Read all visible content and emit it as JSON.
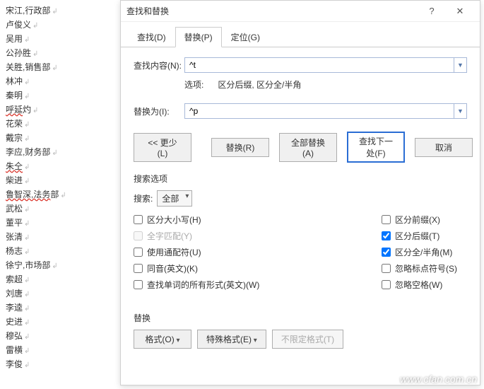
{
  "doc_lines": [
    {
      "text": "宋江,行政部",
      "wavy": false
    },
    {
      "text": "卢俊义",
      "wavy": false
    },
    {
      "text": "吴用",
      "wavy": false
    },
    {
      "text": "公孙胜",
      "wavy": false
    },
    {
      "text": "关胜,销售部",
      "wavy": false
    },
    {
      "text": "林冲",
      "wavy": false
    },
    {
      "text": "秦明",
      "wavy": false
    },
    {
      "text": "呼延",
      "wavy": true,
      "suffix": "灼"
    },
    {
      "text": "花荣",
      "wavy": false
    },
    {
      "text": "戴宗",
      "wavy": false
    },
    {
      "text": "李应,财务部",
      "wavy": false
    },
    {
      "text": "朱仝",
      "wavy": true
    },
    {
      "text": "柴进",
      "wavy": false
    },
    {
      "text": "鲁智深,法务",
      "wavy": true,
      "suffix": "部"
    },
    {
      "text": "武松",
      "wavy": false
    },
    {
      "text": "董平",
      "wavy": false
    },
    {
      "text": "张清",
      "wavy": false
    },
    {
      "text": "杨志",
      "wavy": false
    },
    {
      "text": "徐宁,市场部",
      "wavy": false
    },
    {
      "text": "索超",
      "wavy": false
    },
    {
      "text": "刘唐",
      "wavy": false
    },
    {
      "text": "李逵",
      "wavy": false
    },
    {
      "text": "史进",
      "wavy": false
    },
    {
      "text": "穆弘",
      "wavy": false
    },
    {
      "text": "雷横",
      "wavy": false
    },
    {
      "text": "李俊",
      "wavy": false
    }
  ],
  "dialog": {
    "title": "查找和替换",
    "tabs": {
      "find": "查找(D)",
      "replace": "替换(P)",
      "goto": "定位(G)"
    },
    "find_label": "查找内容(N):",
    "find_value": "^t",
    "options_label": "选项:",
    "options_value": "区分后缀, 区分全/半角",
    "replace_label": "替换为(I):",
    "replace_value": "^p",
    "buttons": {
      "less": "<< 更少(L)",
      "replace": "替换(R)",
      "replace_all": "全部替换(A)",
      "find_next": "查找下一处(F)",
      "cancel": "取消"
    },
    "search_options_title": "搜索选项",
    "search_dir_label": "搜索:",
    "search_dir_value": "全部",
    "checks": {
      "match_case": "区分大小写(H)",
      "whole_word": "全字匹配(Y)",
      "wildcards": "使用通配符(U)",
      "sounds_like": "同音(英文)(K)",
      "word_forms": "查找单词的所有形式(英文)(W)",
      "prefix": "区分前缀(X)",
      "suffix": "区分后缀(T)",
      "fullwidth": "区分全/半角(M)",
      "punctuation": "忽略标点符号(S)",
      "whitespace": "忽略空格(W)"
    },
    "replace_section": "替换",
    "fmt_buttons": {
      "format": "格式(O)",
      "special": "特殊格式(E)",
      "no_format": "不限定格式(T)"
    }
  },
  "watermark": "www.cfan.com.cn"
}
